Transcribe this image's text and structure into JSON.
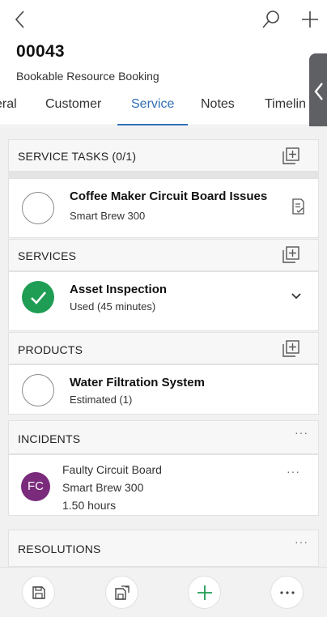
{
  "header": {
    "record_number": "00043",
    "record_type": "Bookable Resource Booking"
  },
  "tabs": [
    {
      "label": "eral"
    },
    {
      "label": "Customer"
    },
    {
      "label": "Service",
      "active": true
    },
    {
      "label": "Notes"
    },
    {
      "label": "Timelin"
    }
  ],
  "service_tasks": {
    "title": "SERVICE TASKS (0/1)",
    "items": [
      {
        "name": "Coffee Maker Circuit Board Issues",
        "detail": "Smart Brew 300",
        "completed": false
      }
    ]
  },
  "services": {
    "title": "SERVICES",
    "items": [
      {
        "name": "Asset Inspection",
        "detail": "Used (45 minutes)",
        "completed": true
      }
    ]
  },
  "products": {
    "title": "PRODUCTS",
    "items": [
      {
        "name": "Water Filtration System",
        "detail": "Estimated (1)",
        "completed": false
      }
    ]
  },
  "incidents": {
    "title": "INCIDENTS",
    "more": "···",
    "items": [
      {
        "initials": "FC",
        "name": "Faulty Circuit Board",
        "asset": "Smart Brew 300",
        "duration": "1.50 hours",
        "more": "···",
        "avatar_color": "#7a2b7c"
      }
    ]
  },
  "resolutions": {
    "title": "RESOLUTIONS",
    "more": "···"
  },
  "icons": {
    "back": "back-arrow-icon",
    "search": "search-icon",
    "add": "plus-icon",
    "section_add": "add-record-icon",
    "task_detail": "task-checklist-icon",
    "expand": "chevron-down-icon",
    "save": "save-icon",
    "save_close": "save-and-close-icon",
    "new": "plus-icon",
    "more": "more-icon"
  },
  "colors": {
    "accent": "#2f6db5",
    "complete": "#1f9d55",
    "avatar": "#7a2b7c",
    "new_button": "#1f9d55"
  }
}
